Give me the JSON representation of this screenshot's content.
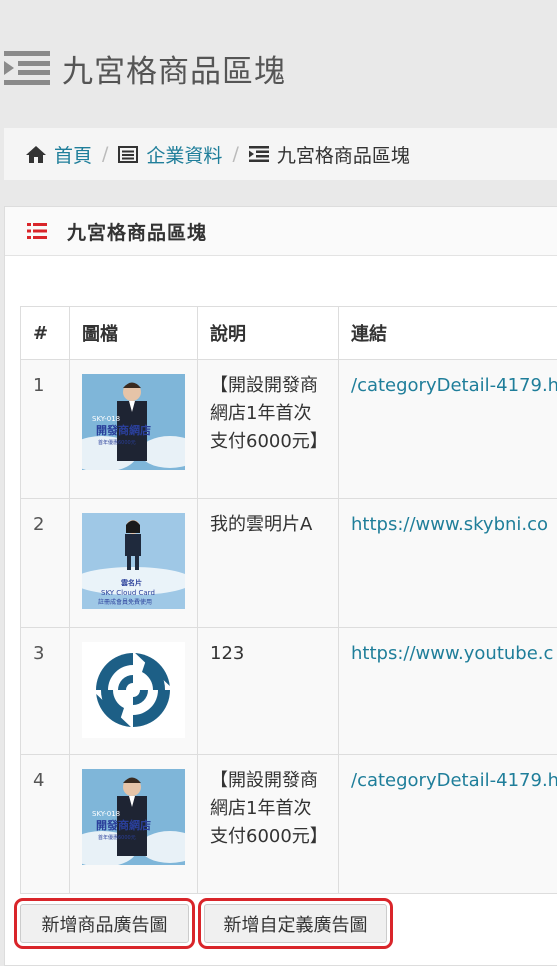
{
  "page": {
    "title": "九宮格商品區塊"
  },
  "breadcrumb": [
    {
      "label": "首頁",
      "icon": "home-icon"
    },
    {
      "label": "企業資料",
      "icon": "list-alt-icon"
    },
    {
      "label": "九宮格商品區塊",
      "icon": "indent-icon"
    }
  ],
  "panel": {
    "title": "九宮格商品區塊",
    "icon": "list-icon"
  },
  "table": {
    "headers": [
      "#",
      "圖檔",
      "說明",
      "連結"
    ],
    "rows": [
      {
        "num": "1",
        "image": "sky-018-storefront-ad",
        "image_text": [
          "SKY-018",
          "開發商網店",
          "首年優惠6000元"
        ],
        "desc": "【開設開發商網店1年首次支付6000元】",
        "link": "/categoryDetail-4179.h"
      },
      {
        "num": "2",
        "image": "sky-cloud-card-ad",
        "image_text": [
          "雲名片",
          "SKY Cloud Card",
          "註冊成會員免費使用"
        ],
        "desc": "我的雲明片A",
        "link": "https://www.skybni.co"
      },
      {
        "num": "3",
        "image": "blue-spiral-logo",
        "image_text": [],
        "desc": "123",
        "link": "https://www.youtube.c"
      },
      {
        "num": "4",
        "image": "sky-018-storefront-ad",
        "image_text": [
          "SKY-018",
          "開發商網店",
          "首年優惠6000元"
        ],
        "desc": "【開設開發商網店1年首次支付6000元】",
        "link": "/categoryDetail-4179.h"
      }
    ]
  },
  "buttons": {
    "add_product_ad": "新增商品廣告圖",
    "add_custom_ad": "新增自定義廣告圖"
  },
  "colors": {
    "link": "#1f7e9a",
    "accent_red": "#d9252a",
    "highlight": "#d9252a"
  }
}
